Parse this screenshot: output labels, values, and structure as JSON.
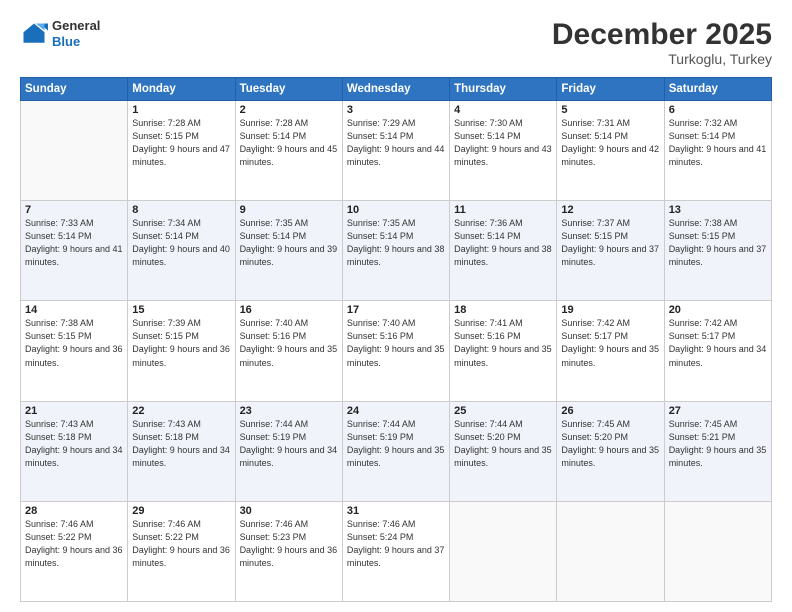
{
  "logo": {
    "general": "General",
    "blue": "Blue"
  },
  "header": {
    "month": "December 2025",
    "location": "Turkoglu, Turkey"
  },
  "weekdays": [
    "Sunday",
    "Monday",
    "Tuesday",
    "Wednesday",
    "Thursday",
    "Friday",
    "Saturday"
  ],
  "weeks": [
    [
      {
        "day": "",
        "sunrise": "",
        "sunset": "",
        "daylight": ""
      },
      {
        "day": "1",
        "sunrise": "Sunrise: 7:28 AM",
        "sunset": "Sunset: 5:15 PM",
        "daylight": "Daylight: 9 hours and 47 minutes."
      },
      {
        "day": "2",
        "sunrise": "Sunrise: 7:28 AM",
        "sunset": "Sunset: 5:14 PM",
        "daylight": "Daylight: 9 hours and 45 minutes."
      },
      {
        "day": "3",
        "sunrise": "Sunrise: 7:29 AM",
        "sunset": "Sunset: 5:14 PM",
        "daylight": "Daylight: 9 hours and 44 minutes."
      },
      {
        "day": "4",
        "sunrise": "Sunrise: 7:30 AM",
        "sunset": "Sunset: 5:14 PM",
        "daylight": "Daylight: 9 hours and 43 minutes."
      },
      {
        "day": "5",
        "sunrise": "Sunrise: 7:31 AM",
        "sunset": "Sunset: 5:14 PM",
        "daylight": "Daylight: 9 hours and 42 minutes."
      },
      {
        "day": "6",
        "sunrise": "Sunrise: 7:32 AM",
        "sunset": "Sunset: 5:14 PM",
        "daylight": "Daylight: 9 hours and 41 minutes."
      }
    ],
    [
      {
        "day": "7",
        "sunrise": "Sunrise: 7:33 AM",
        "sunset": "Sunset: 5:14 PM",
        "daylight": "Daylight: 9 hours and 41 minutes."
      },
      {
        "day": "8",
        "sunrise": "Sunrise: 7:34 AM",
        "sunset": "Sunset: 5:14 PM",
        "daylight": "Daylight: 9 hours and 40 minutes."
      },
      {
        "day": "9",
        "sunrise": "Sunrise: 7:35 AM",
        "sunset": "Sunset: 5:14 PM",
        "daylight": "Daylight: 9 hours and 39 minutes."
      },
      {
        "day": "10",
        "sunrise": "Sunrise: 7:35 AM",
        "sunset": "Sunset: 5:14 PM",
        "daylight": "Daylight: 9 hours and 38 minutes."
      },
      {
        "day": "11",
        "sunrise": "Sunrise: 7:36 AM",
        "sunset": "Sunset: 5:14 PM",
        "daylight": "Daylight: 9 hours and 38 minutes."
      },
      {
        "day": "12",
        "sunrise": "Sunrise: 7:37 AM",
        "sunset": "Sunset: 5:15 PM",
        "daylight": "Daylight: 9 hours and 37 minutes."
      },
      {
        "day": "13",
        "sunrise": "Sunrise: 7:38 AM",
        "sunset": "Sunset: 5:15 PM",
        "daylight": "Daylight: 9 hours and 37 minutes."
      }
    ],
    [
      {
        "day": "14",
        "sunrise": "Sunrise: 7:38 AM",
        "sunset": "Sunset: 5:15 PM",
        "daylight": "Daylight: 9 hours and 36 minutes."
      },
      {
        "day": "15",
        "sunrise": "Sunrise: 7:39 AM",
        "sunset": "Sunset: 5:15 PM",
        "daylight": "Daylight: 9 hours and 36 minutes."
      },
      {
        "day": "16",
        "sunrise": "Sunrise: 7:40 AM",
        "sunset": "Sunset: 5:16 PM",
        "daylight": "Daylight: 9 hours and 35 minutes."
      },
      {
        "day": "17",
        "sunrise": "Sunrise: 7:40 AM",
        "sunset": "Sunset: 5:16 PM",
        "daylight": "Daylight: 9 hours and 35 minutes."
      },
      {
        "day": "18",
        "sunrise": "Sunrise: 7:41 AM",
        "sunset": "Sunset: 5:16 PM",
        "daylight": "Daylight: 9 hours and 35 minutes."
      },
      {
        "day": "19",
        "sunrise": "Sunrise: 7:42 AM",
        "sunset": "Sunset: 5:17 PM",
        "daylight": "Daylight: 9 hours and 35 minutes."
      },
      {
        "day": "20",
        "sunrise": "Sunrise: 7:42 AM",
        "sunset": "Sunset: 5:17 PM",
        "daylight": "Daylight: 9 hours and 34 minutes."
      }
    ],
    [
      {
        "day": "21",
        "sunrise": "Sunrise: 7:43 AM",
        "sunset": "Sunset: 5:18 PM",
        "daylight": "Daylight: 9 hours and 34 minutes."
      },
      {
        "day": "22",
        "sunrise": "Sunrise: 7:43 AM",
        "sunset": "Sunset: 5:18 PM",
        "daylight": "Daylight: 9 hours and 34 minutes."
      },
      {
        "day": "23",
        "sunrise": "Sunrise: 7:44 AM",
        "sunset": "Sunset: 5:19 PM",
        "daylight": "Daylight: 9 hours and 34 minutes."
      },
      {
        "day": "24",
        "sunrise": "Sunrise: 7:44 AM",
        "sunset": "Sunset: 5:19 PM",
        "daylight": "Daylight: 9 hours and 35 minutes."
      },
      {
        "day": "25",
        "sunrise": "Sunrise: 7:44 AM",
        "sunset": "Sunset: 5:20 PM",
        "daylight": "Daylight: 9 hours and 35 minutes."
      },
      {
        "day": "26",
        "sunrise": "Sunrise: 7:45 AM",
        "sunset": "Sunset: 5:20 PM",
        "daylight": "Daylight: 9 hours and 35 minutes."
      },
      {
        "day": "27",
        "sunrise": "Sunrise: 7:45 AM",
        "sunset": "Sunset: 5:21 PM",
        "daylight": "Daylight: 9 hours and 35 minutes."
      }
    ],
    [
      {
        "day": "28",
        "sunrise": "Sunrise: 7:46 AM",
        "sunset": "Sunset: 5:22 PM",
        "daylight": "Daylight: 9 hours and 36 minutes."
      },
      {
        "day": "29",
        "sunrise": "Sunrise: 7:46 AM",
        "sunset": "Sunset: 5:22 PM",
        "daylight": "Daylight: 9 hours and 36 minutes."
      },
      {
        "day": "30",
        "sunrise": "Sunrise: 7:46 AM",
        "sunset": "Sunset: 5:23 PM",
        "daylight": "Daylight: 9 hours and 36 minutes."
      },
      {
        "day": "31",
        "sunrise": "Sunrise: 7:46 AM",
        "sunset": "Sunset: 5:24 PM",
        "daylight": "Daylight: 9 hours and 37 minutes."
      },
      {
        "day": "",
        "sunrise": "",
        "sunset": "",
        "daylight": ""
      },
      {
        "day": "",
        "sunrise": "",
        "sunset": "",
        "daylight": ""
      },
      {
        "day": "",
        "sunrise": "",
        "sunset": "",
        "daylight": ""
      }
    ]
  ]
}
